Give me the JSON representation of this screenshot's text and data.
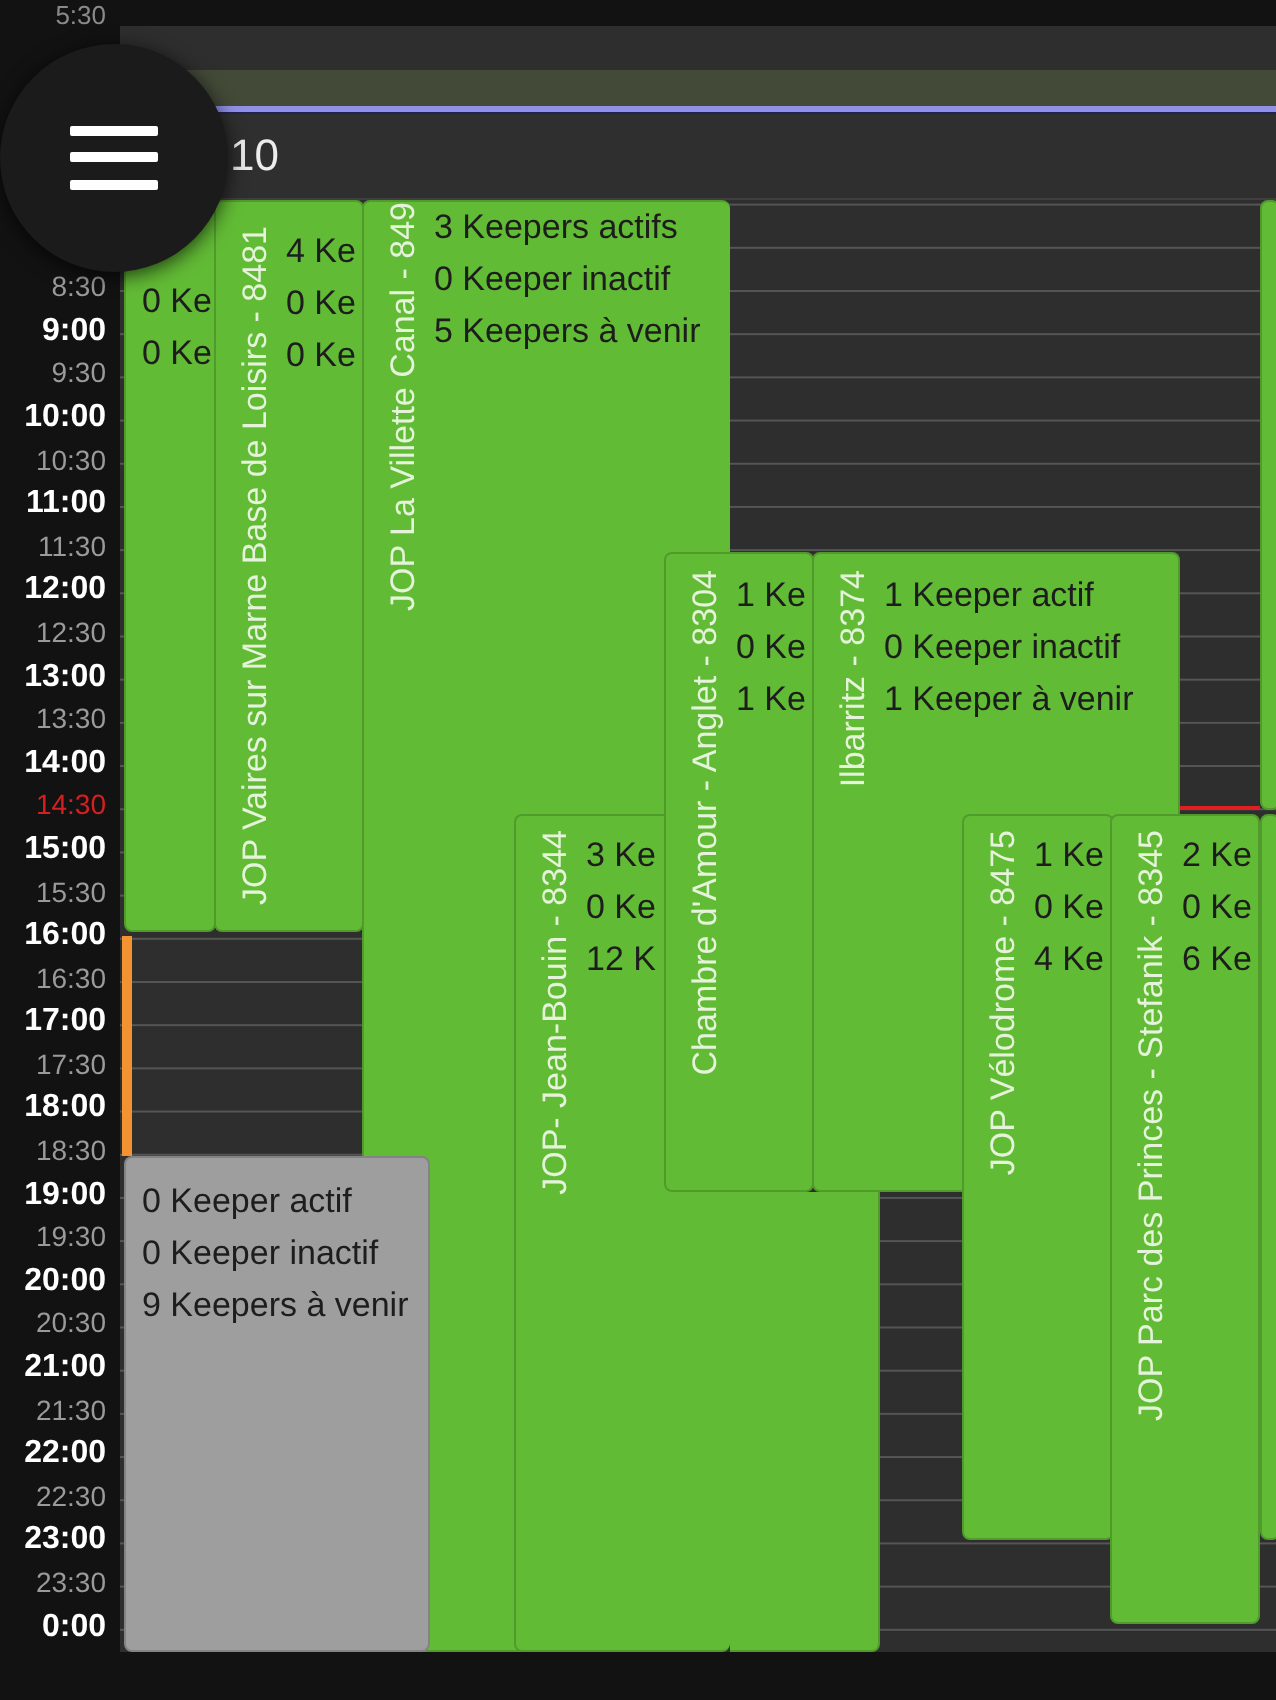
{
  "top_strip": {
    "time_label": "5:30"
  },
  "header": {
    "date": "10"
  },
  "time_labels": [
    {
      "label": "8:30",
      "kind": "half",
      "current": false
    },
    {
      "label": "9:00",
      "kind": "hour",
      "current": false
    },
    {
      "label": "9:30",
      "kind": "half",
      "current": false
    },
    {
      "label": "10:00",
      "kind": "hour",
      "current": false
    },
    {
      "label": "10:30",
      "kind": "half",
      "current": false
    },
    {
      "label": "11:00",
      "kind": "hour",
      "current": false
    },
    {
      "label": "11:30",
      "kind": "half",
      "current": false
    },
    {
      "label": "12:00",
      "kind": "hour",
      "current": false
    },
    {
      "label": "12:30",
      "kind": "half",
      "current": false
    },
    {
      "label": "13:00",
      "kind": "hour",
      "current": false
    },
    {
      "label": "13:30",
      "kind": "half",
      "current": false
    },
    {
      "label": "14:00",
      "kind": "hour",
      "current": false
    },
    {
      "label": "14:30",
      "kind": "half",
      "current": true
    },
    {
      "label": "15:00",
      "kind": "hour",
      "current": false
    },
    {
      "label": "15:30",
      "kind": "half",
      "current": false
    },
    {
      "label": "16:00",
      "kind": "hour",
      "current": false
    },
    {
      "label": "16:30",
      "kind": "half",
      "current": false
    },
    {
      "label": "17:00",
      "kind": "hour",
      "current": false
    },
    {
      "label": "17:30",
      "kind": "half",
      "current": false
    },
    {
      "label": "18:00",
      "kind": "hour",
      "current": false
    },
    {
      "label": "18:30",
      "kind": "half",
      "current": false
    },
    {
      "label": "19:00",
      "kind": "hour",
      "current": false
    },
    {
      "label": "19:30",
      "kind": "half",
      "current": false
    },
    {
      "label": "20:00",
      "kind": "hour",
      "current": false
    },
    {
      "label": "20:30",
      "kind": "half",
      "current": false
    },
    {
      "label": "21:00",
      "kind": "hour",
      "current": false
    },
    {
      "label": "21:30",
      "kind": "half",
      "current": false
    },
    {
      "label": "22:00",
      "kind": "hour",
      "current": false
    },
    {
      "label": "22:30",
      "kind": "half",
      "current": false
    },
    {
      "label": "23:00",
      "kind": "hour",
      "current": false
    },
    {
      "label": "23:30",
      "kind": "half",
      "current": false
    },
    {
      "label": "0:00",
      "kind": "hour",
      "current": false
    }
  ],
  "events": [
    {
      "color": "#62bb35",
      "lines": [
        "0 Ke",
        "0 Ke"
      ]
    },
    {
      "title": "JOP Vaires sur Marne Base de Loisirs - 8481",
      "color": "#62bb35",
      "lines": [
        "4 Ke",
        "0 Ke",
        "0 Ke"
      ]
    },
    {
      "title": "JOP La Villette Canal - 849",
      "color": "#62bb35",
      "lines": [
        "3 Keepers actifs",
        "0 Keeper inactif",
        "5 Keepers à venir"
      ]
    },
    {
      "title": "JOP- Jean-Bouin - 8344",
      "color": "#62bb35",
      "lines": [
        "3 Ke",
        "0 Ke",
        "12 K"
      ]
    },
    {
      "color": "#62bb35"
    },
    {
      "title": "Chambre d'Amour - Anglet - 8304",
      "color": "#62bb35",
      "lines": [
        "1 Ke",
        "0 Ke",
        "1 Ke"
      ]
    },
    {
      "title": "Ilbarritz - 8374",
      "color": "#62bb35",
      "lines": [
        "1 Keeper actif",
        "0 Keeper inactif",
        "1 Keeper à venir"
      ]
    },
    {
      "title": "JOP Vélodrome - 8475",
      "color": "#62bb35",
      "lines": [
        "1 Ke",
        "0 Ke",
        "4 Ke"
      ]
    },
    {
      "title": "JOP Parc des Princes - Stefanik - 8345",
      "color": "#62bb35",
      "lines": [
        "2 Ke",
        "0 Ke",
        "6 Ke"
      ]
    },
    {
      "color": "#62bb35"
    },
    {
      "color": "#62bb35"
    },
    {
      "color": "#9e9e9e",
      "lines": [
        "0 Keeper actif",
        "0 Keeper inactif",
        "9 Keepers à venir"
      ]
    }
  ]
}
